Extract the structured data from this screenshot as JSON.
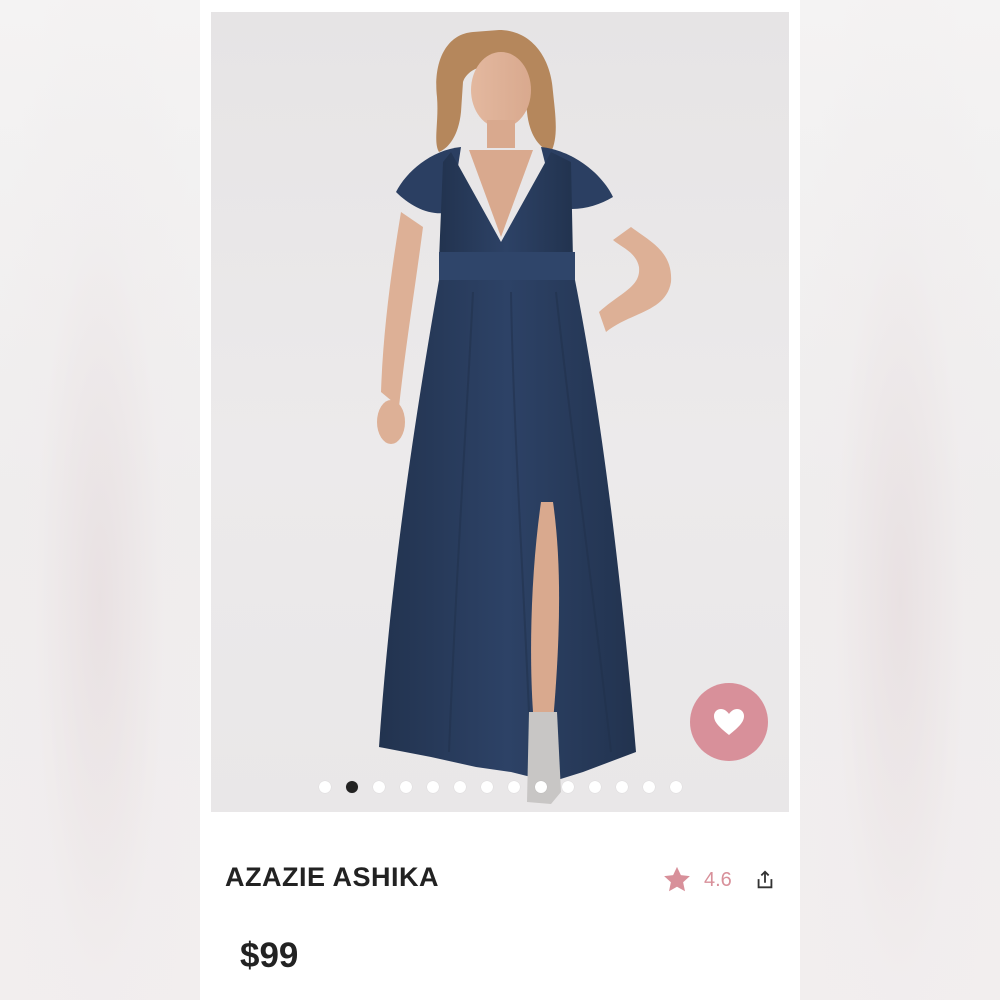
{
  "product": {
    "brand_title": "AZAZIE ASHIKA",
    "price": "$99",
    "rating": "4.6"
  },
  "image": {
    "description_icon": "product-photo",
    "dress_color": "#2a3d5e"
  },
  "carousel": {
    "total_dots": 14,
    "active_index": 1
  },
  "colors": {
    "accent": "#d8909a",
    "text": "#222222"
  },
  "icons": {
    "favorite": "heart-icon",
    "rating": "star-icon",
    "share": "share-icon"
  }
}
